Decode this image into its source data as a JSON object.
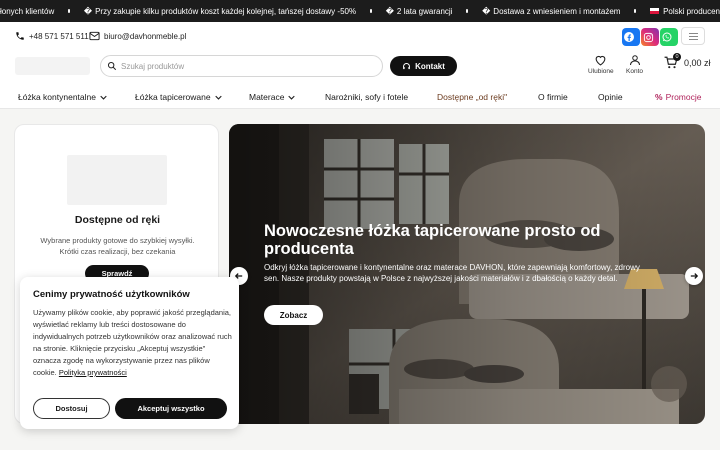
{
  "topbar": {
    "items": [
      {
        "text": "łonych klientów",
        "glyph": ""
      },
      {
        "text": "Przy zakupie kilku produktów koszt każdej kolejnej, tańszej dostawy -50%",
        "glyph": "�"
      },
      {
        "text": "2 lata gwarancji",
        "glyph": "�"
      },
      {
        "text": "Dostawa z wniesieniem i montażem",
        "glyph": "�"
      },
      {
        "text": "Polski producen",
        "glyph": "flag"
      }
    ]
  },
  "contact": {
    "phone": "+48 571 571 511",
    "email": "biuro@davhonmeble.pl",
    "social": [
      {
        "name": "facebook-icon",
        "color": "#1877f2"
      },
      {
        "name": "instagram-icon",
        "color": "#e1306c"
      },
      {
        "name": "whatsapp-icon",
        "color": "#25d366"
      }
    ]
  },
  "header": {
    "search_placeholder": "Szukaj produktów",
    "kontakt_label": "Kontakt",
    "favorites_label": "Ulubione",
    "account_label": "Konto",
    "cart_count": "0",
    "cart_total": "0,00 zł"
  },
  "nav": {
    "items": [
      {
        "label": "Łóżka kontynentalne",
        "dropdown": true
      },
      {
        "label": "Łóżka tapicerowane",
        "dropdown": true
      },
      {
        "label": "Materace",
        "dropdown": true
      },
      {
        "label": "Narożniki, sofy i fotele",
        "dropdown": false
      },
      {
        "label": "Dostępne „od ręki\"",
        "dropdown": false
      },
      {
        "label": "O firmie",
        "dropdown": false
      },
      {
        "label": "Opinie",
        "dropdown": false
      },
      {
        "label": "Promocje",
        "dropdown": false
      }
    ]
  },
  "card": {
    "title": "Dostępne od ręki",
    "desc_line1": "Wybrane produkty gotowe do szybkiej wysyłki.",
    "desc_line2": "Krótki czas realizacji, bez czekania",
    "button": "Sprawdź"
  },
  "hero": {
    "title": "Nowoczesne łóżka tapicerowane prosto od producenta",
    "desc": "Odkryj łóżka tapicerowane i kontynentalne oraz materace DAVHON, które zapewniają komfortowy, zdrowy sen. Nasze produkty powstają w Polsce z najwyższej jakości materiałów i z dbałością o każdy detal.",
    "button": "Zobacz"
  },
  "cookie": {
    "title": "Cenimy prywatność użytkowników",
    "body": "Używamy plików cookie, aby poprawić jakość przeglądania, wyświetlać reklamy lub treści dostosowane do indywidualnych potrzeb użytkowników oraz analizować ruch na stronie. Kliknięcie przycisku „Akceptuj wszystkie\" oznacza zgodę na wykorzystywanie przez nas plików cookie.",
    "link": "Polityka prywatności",
    "customize": "Dostosuj",
    "accept": "Akceptuj wszystko"
  }
}
